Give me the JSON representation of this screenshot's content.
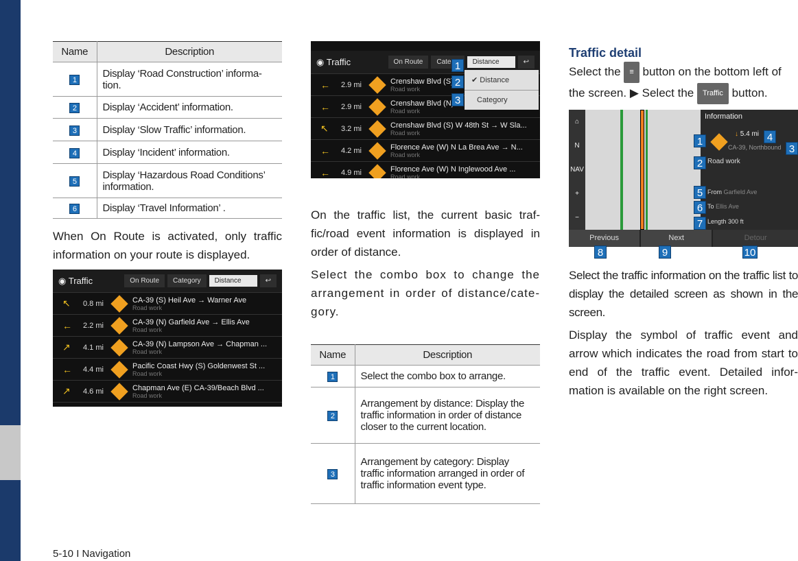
{
  "left": {
    "table": {
      "headers": [
        "Name",
        "Description"
      ],
      "rows": [
        {
          "n": "1",
          "d": "Display ‘Road Construction’ informa-tion."
        },
        {
          "n": "2",
          "d": "Display ‘Accident’ information."
        },
        {
          "n": "3",
          "d": "Display ‘Slow Traffic’ information."
        },
        {
          "n": "4",
          "d": "Display ‘Incident’ information."
        },
        {
          "n": "5",
          "d": "Display ‘Hazardous Road Conditions’ information."
        },
        {
          "n": "6",
          "d": "Display ‘Travel Information’ ."
        }
      ]
    },
    "para": "When On Route is activated, only traffic information on your route is displayed.",
    "shot": {
      "title": "Traffic",
      "on_route": "On Route",
      "category": "Category",
      "combo": "Distance",
      "rows": [
        {
          "arrow": "↖",
          "dist": "0.8 mi",
          "road": "CA-39 (S) Heil Ave → Warner Ave",
          "type": "Road work"
        },
        {
          "arrow": "←",
          "dist": "2.2 mi",
          "road": "CA-39 (N) Garfield Ave → Ellis Ave",
          "type": "Road work"
        },
        {
          "arrow": "↗",
          "dist": "4.1 mi",
          "road": "CA-39 (N) Lampson Ave → Chapman ...",
          "type": "Road work"
        },
        {
          "arrow": "←",
          "dist": "4.4 mi",
          "road": "Pacific Coast Hwy (S) Goldenwest St ...",
          "type": "Road work"
        },
        {
          "arrow": "↗",
          "dist": "4.6 mi",
          "road": "Chapman Ave (E) CA-39/Beach Blvd ...",
          "type": "Road work"
        }
      ]
    }
  },
  "middle": {
    "shot": {
      "title": "Traffic",
      "on_route": "On Route",
      "category": "Catego",
      "combo": "Distance",
      "menu": [
        "Distance",
        "Category"
      ],
      "rows": [
        {
          "arrow": "←",
          "dist": "2.9 mi",
          "road": "Crenshaw Blvd (S)",
          "type": "Road work"
        },
        {
          "arrow": "←",
          "dist": "2.9 mi",
          "road": "Crenshaw Blvd (N)",
          "type": "Road work"
        },
        {
          "arrow": "↖",
          "dist": "3.2 mi",
          "road": "Crenshaw Blvd (S) W 48th St → W Sla...",
          "type": "Road work"
        },
        {
          "arrow": "←",
          "dist": "4.2 mi",
          "road": "Florence Ave (W) N La Brea Ave → N...",
          "type": "Road work"
        },
        {
          "arrow": "←",
          "dist": "4.9 mi",
          "road": "Florence Ave (W) N Inglewood Ave ...",
          "type": "Road work"
        }
      ]
    },
    "para1": "On the traffic list, the current basic traf-fic/road event information is displayed in order of distance.",
    "para2": "Select the combo box to change the arrangement in order of distance/cate-gory.",
    "table": {
      "headers": [
        "Name",
        "Description"
      ],
      "rows": [
        {
          "n": "1",
          "d": "Select the combo box to arrange."
        },
        {
          "n": "2",
          "d": "Arrangement by distance: Display the traffic information in order of distance closer to the current location."
        },
        {
          "n": "3",
          "d": "Arrangement by category: Display traffic information arranged in order of traffic information event type."
        }
      ]
    }
  },
  "right": {
    "heading": "Traffic detail",
    "p1a": "Select the",
    "p1b": "button on the bottom left of the screen. ▶ Select the",
    "traffic_btn": "Traffic",
    "p1c": "button.",
    "shot": {
      "info": "Information",
      "dist": "5.4 mi",
      "road": "CA-39, Northbound",
      "type": "Road work",
      "from_l": "From",
      "from": "Garfield Ave",
      "to_l": "To",
      "to": "Ellis Ave",
      "len_l": "Length",
      "len": "300 ft",
      "prev": "Previous",
      "next": "Next",
      "detour": "Detour",
      "side": [
        "N",
        "NAV",
        "+",
        "−"
      ]
    },
    "p2": "Select the traffic information on the traffic list to display the detailed screen as shown in the screen.",
    "p3": "Display the symbol of traffic event and arrow which indicates the road from start to end of the traffic event. Detailed infor-mation is available on the right screen."
  },
  "footer": "5-10 I Navigation"
}
